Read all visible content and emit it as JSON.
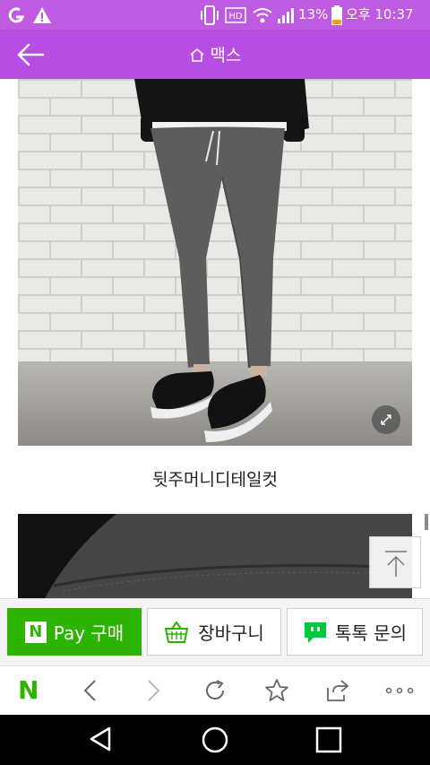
{
  "status_bar": {
    "battery": "13%",
    "time": "오후 10:37",
    "icons": [
      "carrier-logo-icon",
      "warning-icon",
      "vibrate-icon",
      "hd-icon",
      "wifi-icon",
      "signal-icon",
      "battery-icon"
    ]
  },
  "header": {
    "title": "맥스",
    "back_icon": "back-arrow-icon",
    "home_icon": "home-icon"
  },
  "content": {
    "caption": "뒷주머니디테일컷"
  },
  "buy_bar": {
    "npay_logo": "N",
    "npay_label": "Pay 구매",
    "cart_label": "장바구니",
    "talk_label": "톡톡 문의"
  },
  "browser_toolbar": {
    "naver_logo": "N",
    "icons": [
      "back-icon",
      "forward-icon",
      "refresh-icon",
      "bookmark-star-icon",
      "share-icon",
      "more-icon"
    ]
  },
  "colors": {
    "accent": "#b84de3",
    "npay_green": "#2db400",
    "talk_green": "#00c73c"
  }
}
